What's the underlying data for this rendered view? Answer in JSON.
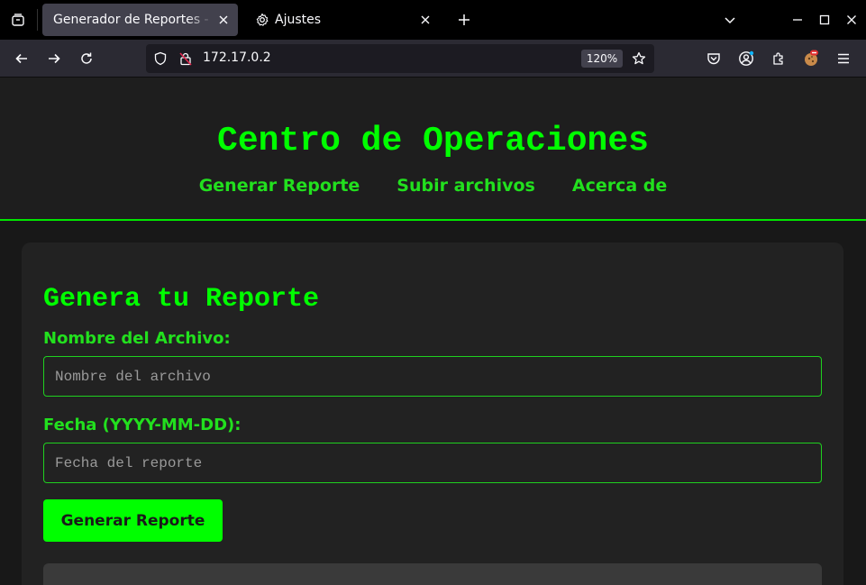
{
  "browser": {
    "tabs": [
      {
        "title": "Generador de Reportes - Centro de Operaciones",
        "active": true
      },
      {
        "title": "Ajustes",
        "active": false
      }
    ],
    "url": "172.17.0.2",
    "zoom": "120%"
  },
  "site": {
    "title": "Centro de Operaciones",
    "nav": [
      "Generar Reporte",
      "Subir archivos",
      "Acerca de"
    ]
  },
  "form": {
    "heading": "Genera tu Reporte",
    "filename": {
      "label": "Nombre del Archivo:",
      "placeholder": "Nombre del archivo"
    },
    "date": {
      "label": "Fecha (YYYY-MM-DD):",
      "placeholder": "Fecha del reporte"
    },
    "submit_label": "Generar Reporte"
  },
  "colors": {
    "accent": "#00ff00",
    "page_bg": "#181818",
    "card_bg": "#222222",
    "browser_toolbar": "#2b2a33"
  }
}
